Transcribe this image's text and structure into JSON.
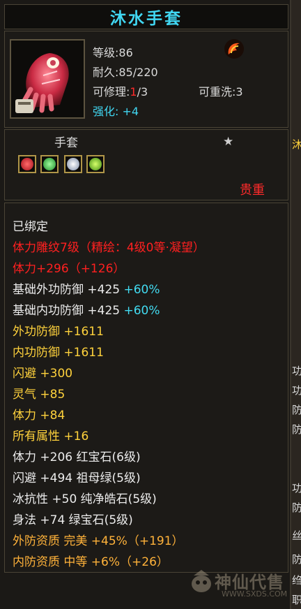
{
  "item": {
    "name": "沐水手套",
    "type": "手套",
    "quality": "贵重",
    "level": "等级:86",
    "durability": "耐久:85/220",
    "repair_label": "可修理:",
    "repair_current": "1",
    "repair_total": "/3",
    "rewash": "可重洗:3",
    "enhance_label": "强化:",
    "enhance_value": "+4",
    "sockets": [
      "red-gem-icon",
      "green-gem-icon",
      "white-gem-icon",
      "emerald-gem-icon"
    ],
    "star_count": 1
  },
  "properties": [
    {
      "text": "已绑定",
      "color": "#ececec"
    },
    {
      "text": "体力雕纹7级（精绘：4级0等·凝望）",
      "color": "#ff2020"
    },
    {
      "text": "体力+296（+126）",
      "color": "#ff2020"
    },
    {
      "text": "基础外功防御 +425 ",
      "suffix": "+60%",
      "color": "#ececec"
    },
    {
      "text": "基础内功防御 +425 ",
      "suffix": "+60%",
      "color": "#ececec"
    },
    {
      "text": "外功防御 +1611",
      "color": "#ffd23c"
    },
    {
      "text": "内功防御 +1611",
      "color": "#ffd23c"
    },
    {
      "text": "闪避 +300",
      "color": "#ffd23c"
    },
    {
      "text": "灵气 +85",
      "color": "#ffd23c"
    },
    {
      "text": "体力 +84",
      "color": "#ffd23c"
    },
    {
      "text": "所有属性 +16",
      "color": "#ffd23c"
    },
    {
      "text": "体力 +206 红宝石(6级)",
      "color": "#ececec"
    },
    {
      "text": "闪避 +494 祖母绿(5级)",
      "color": "#ececec"
    },
    {
      "text": "冰抗性 +50 纯净皓石(5级)",
      "color": "#ececec"
    },
    {
      "text": "身法 +74 绿宝石(5级)",
      "color": "#ececec"
    },
    {
      "text": "外防资质   完美 +45%（+191）",
      "color": "#ffb23a"
    },
    {
      "text": "内防资质   中等 +6%（+26）",
      "color": "#ffb23a"
    }
  ],
  "side_text": [
    "沐",
    "功",
    "功",
    "防",
    "防",
    "功",
    "防",
    "丝",
    "防",
    "绉",
    "职"
  ],
  "watermark": {
    "text": "神仙代售",
    "url": "WWW.SXDS.COM"
  },
  "colors": {
    "title": "#41d7f2",
    "quality": "#ff2a2a",
    "star": "#cfcfcf"
  }
}
